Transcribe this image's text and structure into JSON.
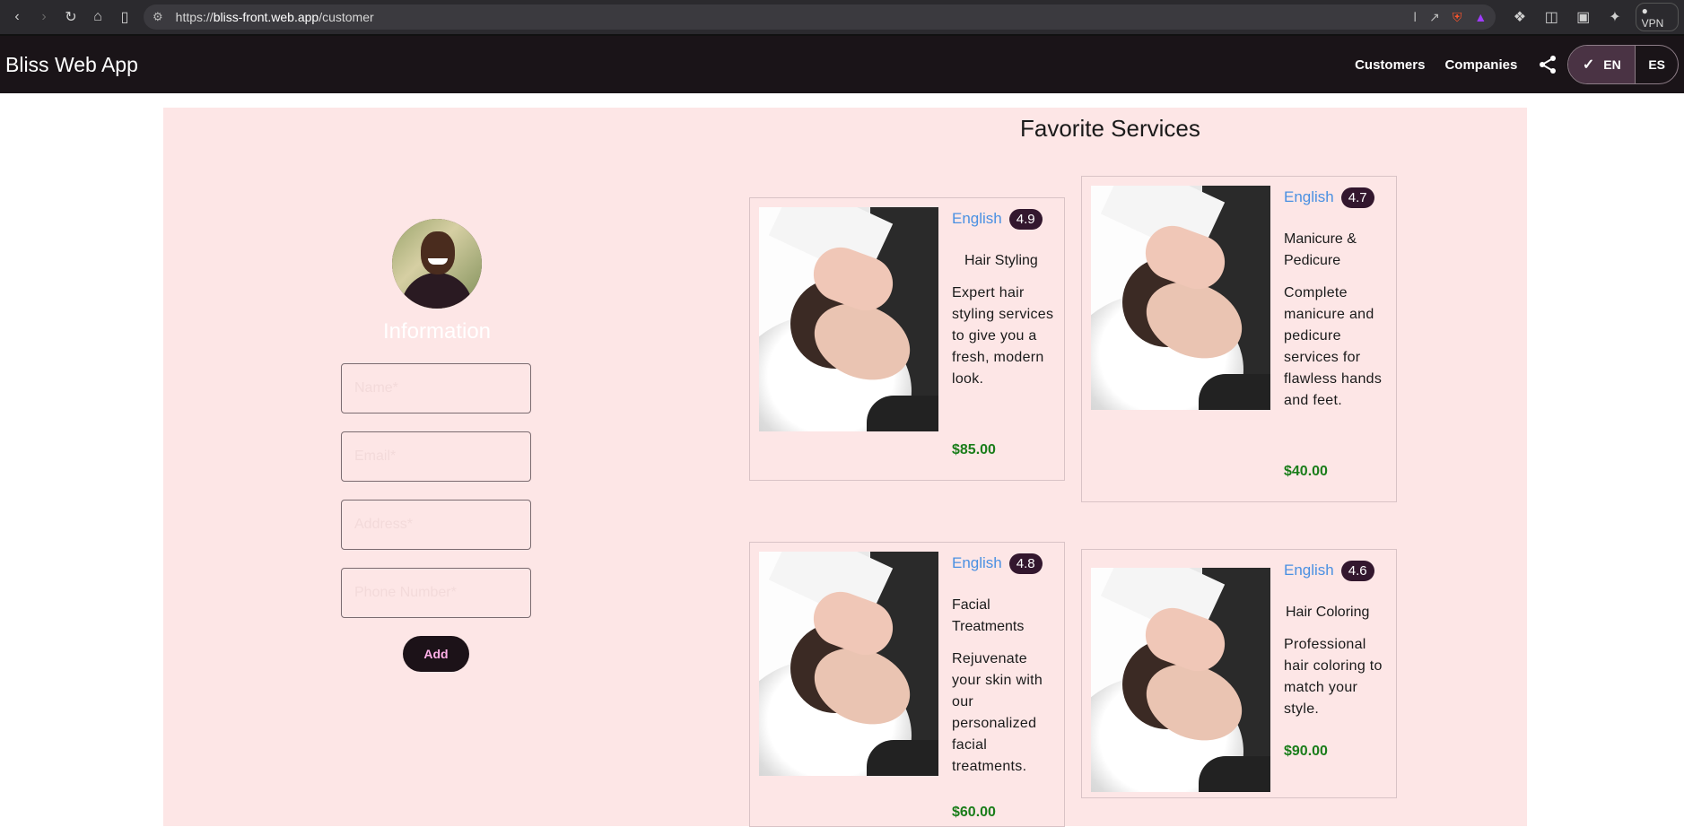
{
  "browser": {
    "url_prefix": "https://",
    "url_host": "bliss-front.web.app",
    "url_path": "/customer",
    "vpn_label": "VPN"
  },
  "appbar": {
    "title": "Bliss Web App",
    "nav": [
      "Customers",
      "Companies"
    ],
    "languages": [
      "EN",
      "ES"
    ],
    "selected_language": "EN"
  },
  "form": {
    "title": "Information",
    "fields": [
      {
        "placeholder": "Name*"
      },
      {
        "placeholder": "Email*"
      },
      {
        "placeholder": "Address*"
      },
      {
        "placeholder": "Phone Number*"
      }
    ],
    "add_label": "Add"
  },
  "favorites": {
    "title": "Favorite Services",
    "services": [
      {
        "language": "English",
        "rating": "4.9",
        "name": "Hair Styling",
        "description": "Expert hair styling services to give you a fresh, modern look.",
        "price": "$85.00"
      },
      {
        "language": "English",
        "rating": "4.7",
        "name": "Manicure & Pedicure",
        "description": "Complete manicure and pedicure services for flawless hands and feet.",
        "price": "$40.00"
      },
      {
        "language": "English",
        "rating": "4.8",
        "name": "Facial Treatments",
        "description": "Rejuvenate your skin with our personalized facial treatments.",
        "price": "$60.00"
      },
      {
        "language": "English",
        "rating": "4.6",
        "name": "Hair Coloring",
        "description": "Professional hair coloring to match your style.",
        "price": "$90.00"
      }
    ]
  },
  "colors": {
    "appbar_bg": "#1a1418",
    "main_bg": "#fde6e6",
    "price": "#1a7d1a",
    "language_link": "#4a90e2",
    "rating_badge": "#33172e"
  }
}
